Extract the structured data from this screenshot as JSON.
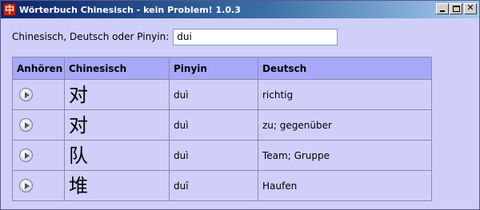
{
  "window": {
    "title": "Wörterbuch Chinesisch - kein Problem! 1.0.3",
    "icon_glyph": "中",
    "accent_color": "#0a246a"
  },
  "search": {
    "label": "Chinesisch, Deutsch oder Pinyin:",
    "value": "dui"
  },
  "table": {
    "headers": {
      "play": "Anhören",
      "chinese": "Chinesisch",
      "pinyin": "Pinyin",
      "german": "Deutsch"
    },
    "rows": [
      {
        "chinese": "对",
        "pinyin": "duì",
        "german": "richtig"
      },
      {
        "chinese": "对",
        "pinyin": "duì",
        "german": "zu; gegenüber"
      },
      {
        "chinese": "队",
        "pinyin": "duì",
        "german": "Team; Gruppe"
      },
      {
        "chinese": "堆",
        "pinyin": "duī",
        "german": "Haufen"
      }
    ]
  },
  "icons": {
    "play": "play-icon",
    "minimize": "minimize-icon",
    "maximize": "maximize-icon",
    "close": "close-icon"
  }
}
